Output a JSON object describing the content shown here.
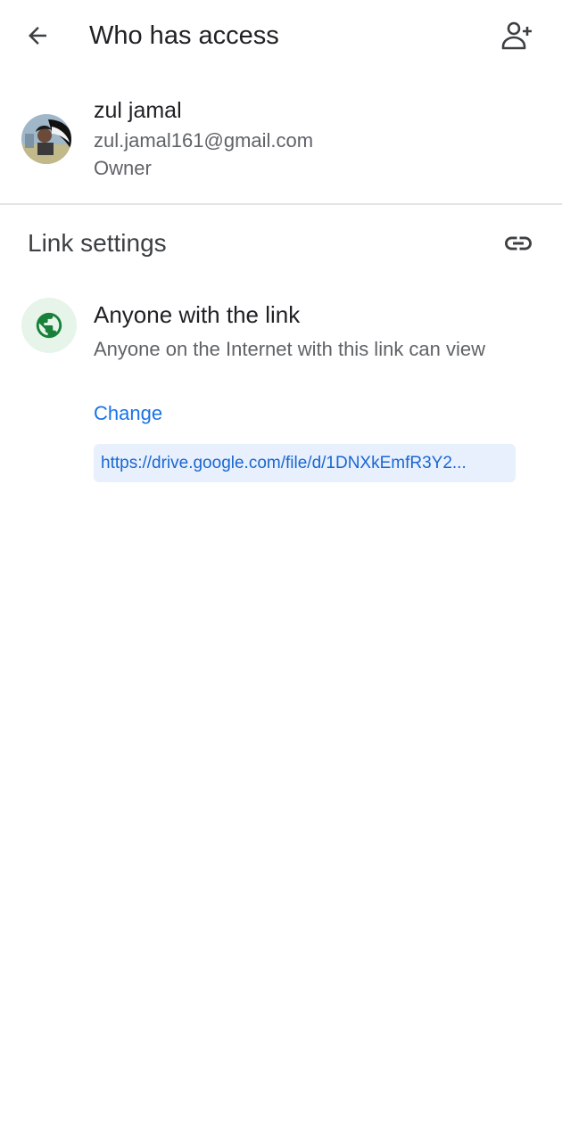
{
  "header": {
    "title": "Who has access",
    "back_icon": "arrow-back-icon",
    "add_person_icon": "person-add-icon"
  },
  "owner": {
    "name": "zul jamal",
    "email": "zul.jamal161@gmail.com",
    "role": "Owner",
    "avatar_icon": "avatar"
  },
  "link_settings": {
    "title": "Link settings",
    "icon": "link-icon",
    "access": {
      "icon": "globe-icon",
      "title": "Anyone with the link",
      "description": "Anyone on the Internet with this link can view",
      "change_label": "Change",
      "url": "https://drive.google.com/file/d/1DNXkEmfR3Y2..."
    }
  },
  "colors": {
    "accent": "#1a73e8",
    "url_chip_bg": "#e8f0fe",
    "globe_bg": "#e6f4ea",
    "globe_fg": "#188038",
    "divider": "#e3e3e3",
    "secondary_text": "#5f6368"
  }
}
